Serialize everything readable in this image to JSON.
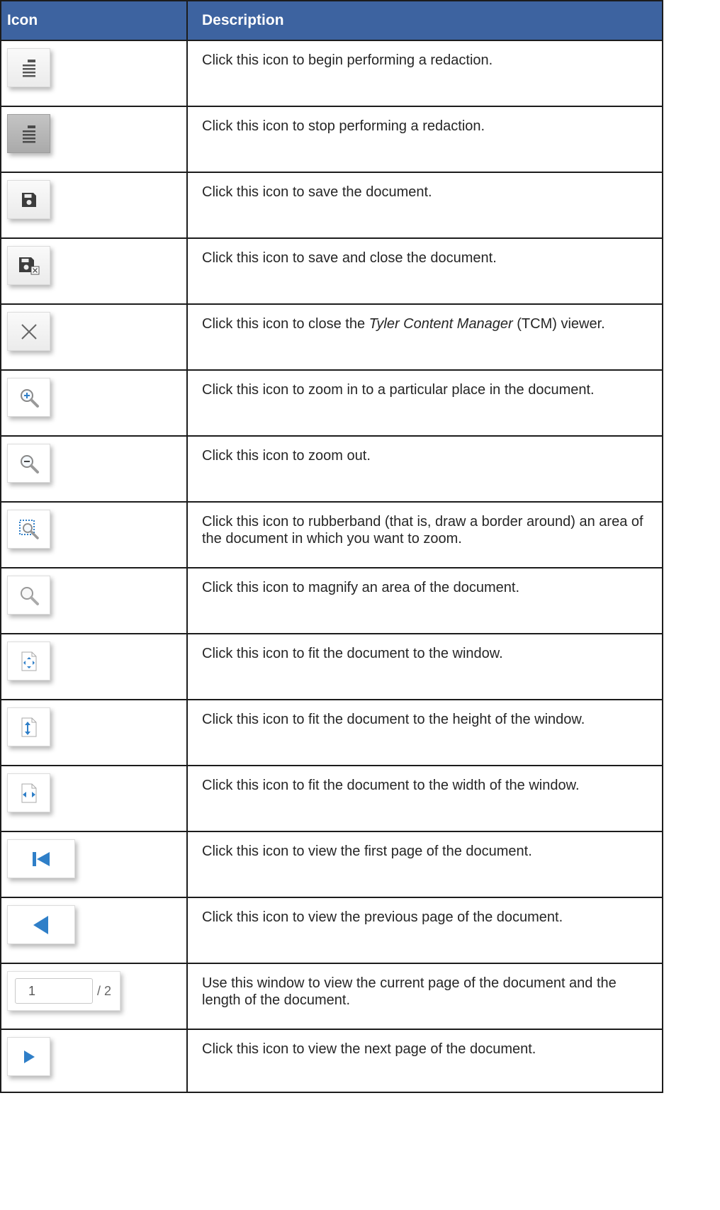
{
  "table": {
    "header": {
      "icon": "Icon",
      "description": "Description"
    },
    "rows": [
      {
        "icon": "start-redaction-icon",
        "description": "Click this icon to begin performing a redaction."
      },
      {
        "icon": "stop-redaction-icon",
        "description": "Click this icon to stop performing a redaction."
      },
      {
        "icon": "save-icon",
        "description": "Click this icon to save the document."
      },
      {
        "icon": "save-close-icon",
        "description": "Click this icon to save and close the document."
      },
      {
        "icon": "close-icon",
        "description_before": "Click this icon to close the ",
        "description_italic": "Tyler Content Manager",
        "description_after": " (TCM) viewer."
      },
      {
        "icon": "zoom-in-icon",
        "description": "Click this icon to zoom in to a particular place in the document."
      },
      {
        "icon": "zoom-out-icon",
        "description": "Click this icon to zoom out."
      },
      {
        "icon": "rubberband-zoom-icon",
        "description": "Click this icon to rubberband (that is, draw a border around) an area of the document in which you want to zoom."
      },
      {
        "icon": "magnify-icon",
        "description": "Click this icon to magnify an area of the document."
      },
      {
        "icon": "fit-window-icon",
        "description": "Click this icon to fit the document to the window."
      },
      {
        "icon": "fit-height-icon",
        "description": "Click this icon to fit the document to the height of the window."
      },
      {
        "icon": "fit-width-icon",
        "description": "Click this icon to fit the document to the width of the window."
      },
      {
        "icon": "first-page-icon",
        "description": "Click this icon to view the first page of the document."
      },
      {
        "icon": "previous-page-icon",
        "description": "Click this icon to view the previous page of the document."
      },
      {
        "icon": "page-indicator",
        "page_current": "1",
        "page_total": "/ 2",
        "description": "Use this window to view the current page of the document and the length of the document."
      },
      {
        "icon": "next-page-icon",
        "description": "Click this icon to view the next page of the document."
      }
    ]
  },
  "colors": {
    "header_bg": "#3d63a0",
    "header_text": "#ffffff",
    "accent_blue": "#2f7fc8",
    "icon_gray": "#555555",
    "grid": "#1c1c1c"
  }
}
